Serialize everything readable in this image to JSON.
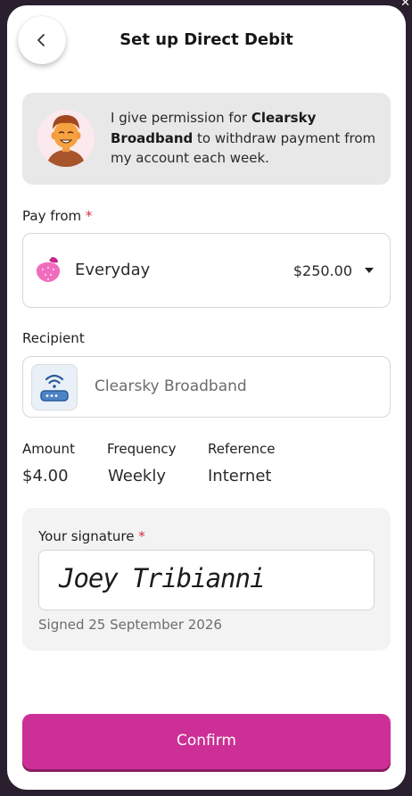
{
  "header": {
    "title": "Set up Direct Debit"
  },
  "consent": {
    "text_before": "I give permission for ",
    "payee_bold": "Clearsky Broadband",
    "text_after": " to withdraw payment from my account each week."
  },
  "pay_from": {
    "label": "Pay from",
    "required_mark": "*",
    "account_name": "Everyday",
    "balance": "$250.00",
    "icon": "strawberry-icon"
  },
  "recipient": {
    "label": "Recipient",
    "name": "Clearsky Broadband",
    "icon": "wifi-router-icon"
  },
  "details": {
    "amount_label": "Amount",
    "amount_value": "$4.00",
    "frequency_label": "Frequency",
    "frequency_value": "Weekly",
    "reference_label": "Reference",
    "reference_value": "Internet"
  },
  "signature": {
    "label": "Your signature",
    "required_mark": "*",
    "value": "Joey Tribianni",
    "signed_on": "Signed 25 September 2026"
  },
  "actions": {
    "confirm_label": "Confirm"
  },
  "colors": {
    "accent": "#cc2f95",
    "required": "#d62b4a",
    "card_background": "#e8e8e8"
  }
}
